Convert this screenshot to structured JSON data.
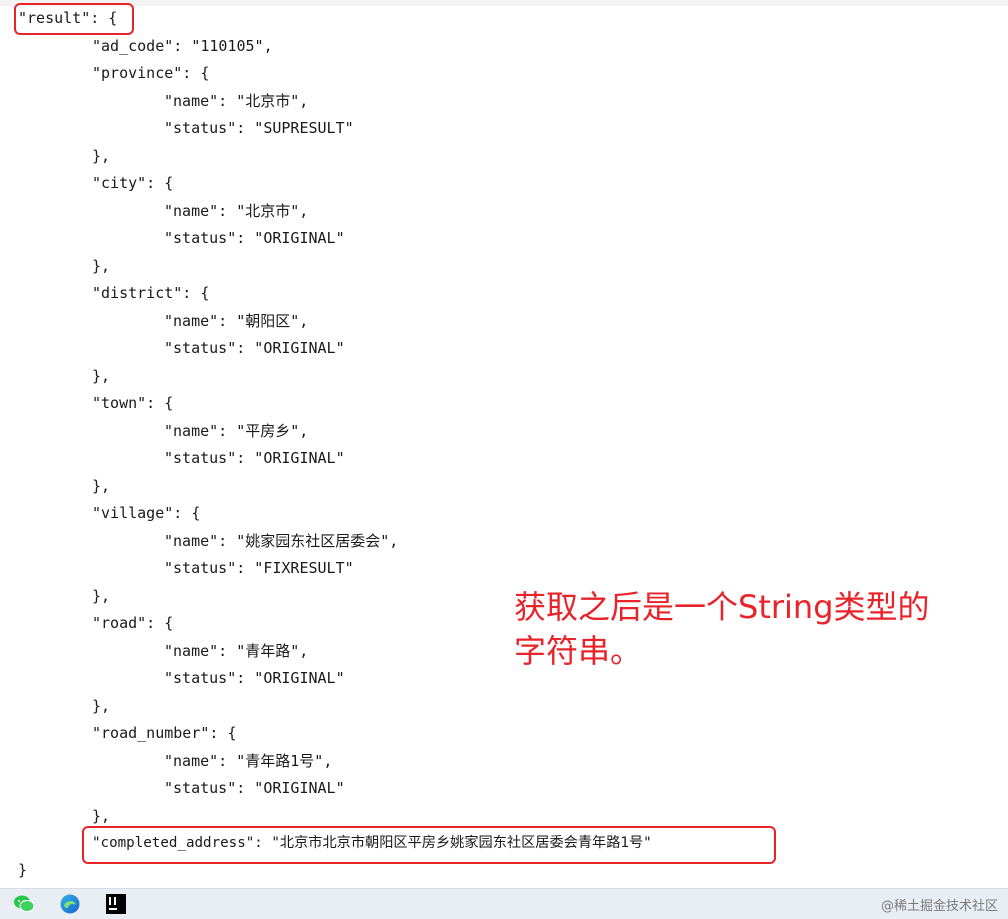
{
  "json_lines": [
    "\"result\": {",
    "\"ad_code\": \"110105\",",
    "\"province\": {",
    "\"name\": \"北京市\",",
    "\"status\": \"SUPRESULT\"",
    "},",
    "\"city\": {",
    "\"name\": \"北京市\",",
    "\"status\": \"ORIGINAL\"",
    "},",
    "\"district\": {",
    "\"name\": \"朝阳区\",",
    "\"status\": \"ORIGINAL\"",
    "},",
    "\"town\": {",
    "\"name\": \"平房乡\",",
    "\"status\": \"ORIGINAL\"",
    "},",
    "\"village\": {",
    "\"name\": \"姚家园东社区居委会\",",
    "\"status\": \"FIXRESULT\"",
    "},",
    "\"road\": {",
    "\"name\": \"青年路\",",
    "\"status\": \"ORIGINAL\"",
    "},",
    "\"road_number\": {",
    "\"name\": \"青年路1号\",",
    "\"status\": \"ORIGINAL\"",
    "},",
    "\"completed_address\": \"北京市北京市朝阳区平房乡姚家园东社区居委会青年路1号\"",
    "}"
  ],
  "annotation": {
    "line1": "获取之后是一个String类型的",
    "line2": "字符串。"
  },
  "taskbar": {
    "watermark": "@稀土掘金技术社区"
  },
  "colors": {
    "highlight": "#e8232a",
    "text": "#1a1a1a"
  }
}
